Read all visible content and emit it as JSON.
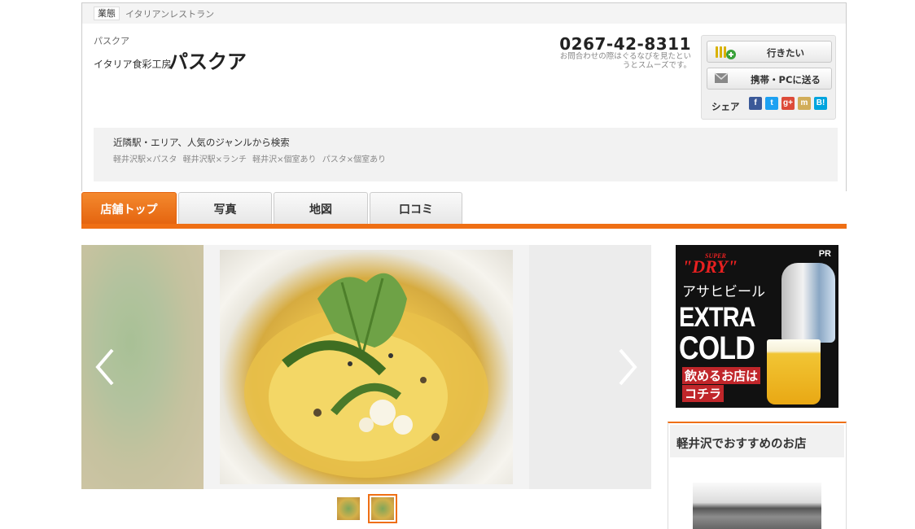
{
  "category": {
    "tag": "業態",
    "value": "イタリアンレストラン"
  },
  "shop": {
    "kana": "パスクア",
    "subtitle": "イタリア食彩工房",
    "name": "パスクア",
    "phone": "0267-42-8311",
    "phone_note": "お問合わせの際はぐるなびを見たというとスムーズです。"
  },
  "actions": {
    "want_label": "行きたい",
    "send_label": "携帯・PCに送る",
    "share_label": "シェア",
    "sns": [
      {
        "label": "f",
        "icon": "facebook-icon",
        "color": "#3b5998"
      },
      {
        "label": "t",
        "icon": "twitter-icon",
        "color": "#1da1f2"
      },
      {
        "label": "g+",
        "icon": "google-plus-icon",
        "color": "#dd4b39"
      },
      {
        "label": "m",
        "icon": "mixi-icon",
        "color": "#d1ad59"
      },
      {
        "label": "B!",
        "icon": "hatena-bookmark-icon",
        "color": "#00a4de"
      }
    ]
  },
  "search": {
    "title": "近隣駅・エリア、人気のジャンルから検索",
    "links": [
      "軽井沢駅×パスタ",
      "軽井沢駅×ランチ",
      "軽井沢×個室あり",
      "パスタ×個室あり"
    ]
  },
  "tabs": [
    {
      "label": "店舗トップ",
      "active": true
    },
    {
      "label": "写真",
      "active": false
    },
    {
      "label": "地図",
      "active": false
    },
    {
      "label": "口コミ",
      "active": false
    }
  ],
  "ad": {
    "pr": "PR",
    "super": "SUPER",
    "dry": "\"DRY\"",
    "brand": "アサヒビール",
    "line1": "EXTRA",
    "line2": "COLD",
    "cta1": "飲めるお店は",
    "cta2": "コチラ"
  },
  "recommend": {
    "title": "軽井沢でおすすめのお店"
  },
  "colors": {
    "accent": "#ef6f14"
  }
}
